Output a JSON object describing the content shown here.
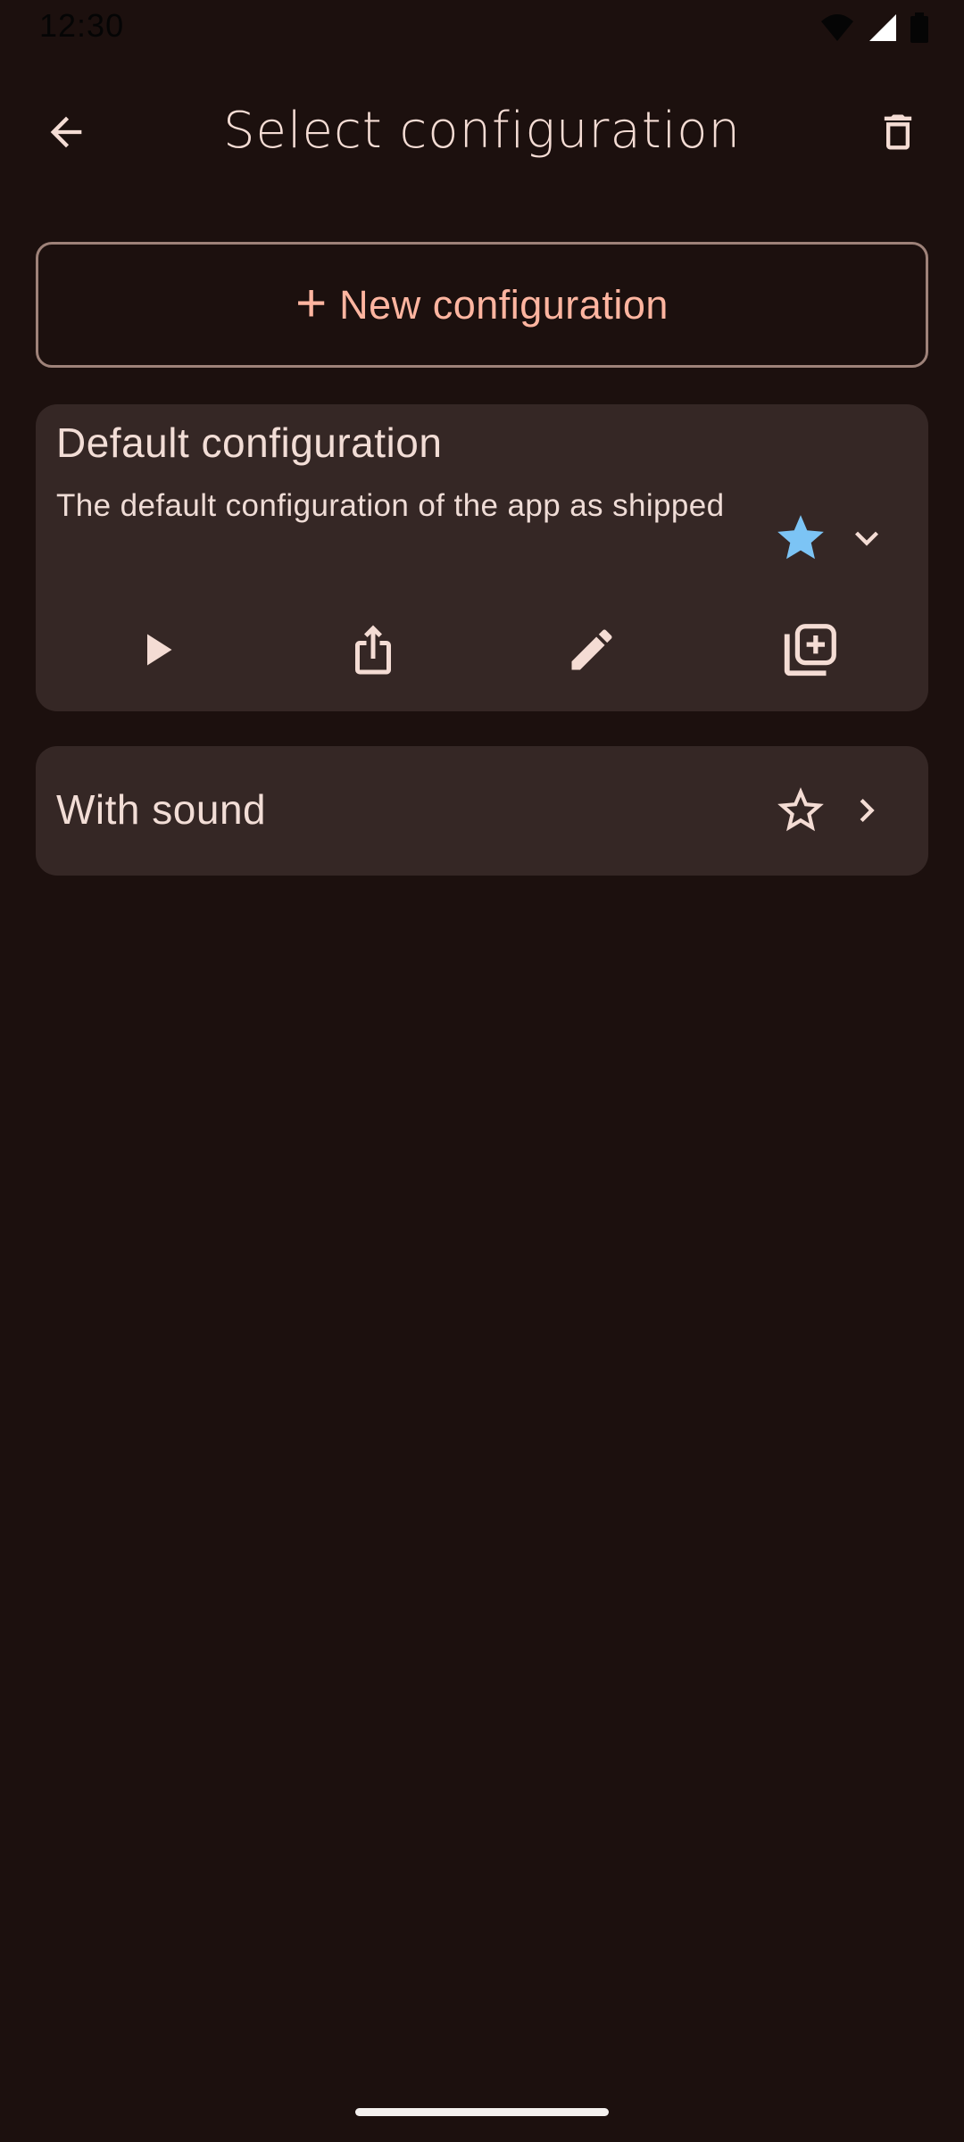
{
  "status_bar": {
    "time": "12:30"
  },
  "app_bar": {
    "title": "Select configuration",
    "back_icon": "arrow-back-icon",
    "delete_icon": "trash-icon"
  },
  "new_config": {
    "plus": "+",
    "label": "New configuration"
  },
  "configurations": [
    {
      "title": "Default configuration",
      "description": "The default configuration of the app as shipped",
      "favorite": true,
      "expanded": true,
      "actions": [
        "play-icon",
        "share-icon",
        "edit-icon",
        "duplicate-icon"
      ]
    },
    {
      "title": "With sound",
      "favorite": false,
      "expanded": false
    }
  ],
  "colors": {
    "background": "#1c100e",
    "card": "#352725",
    "accent": "#ffb5a0",
    "favorite_star": "#7cc4f5",
    "on_surface": "#f2ddd6"
  }
}
